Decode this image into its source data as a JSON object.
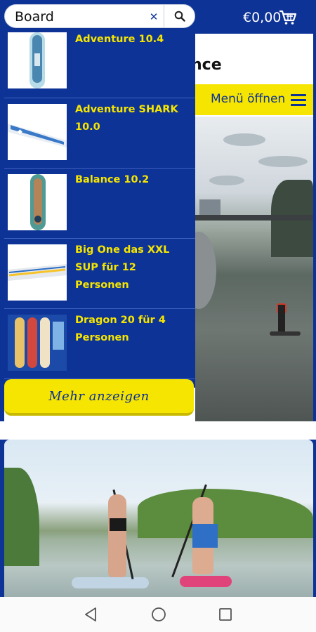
{
  "search": {
    "value": "Board",
    "clear_icon": "close-icon",
    "button_icon": "search-icon"
  },
  "cart": {
    "total": "€0,00",
    "icon": "cart-icon"
  },
  "page": {
    "heading_fragment": "nce"
  },
  "menu": {
    "label": "Menü öffnen",
    "icon": "hamburger-icon"
  },
  "results": [
    {
      "name": "Adventure 10.4"
    },
    {
      "name": "Adventure SHARK 10.0"
    },
    {
      "name": "Balance 10.2"
    },
    {
      "name": "Big One das XXL SUP für 12 Personen"
    },
    {
      "name": "Dragon 20 für 4 Personen"
    }
  ],
  "more_button": {
    "label": "Mehr anzeigen"
  },
  "colors": {
    "brand_blue": "#0d3396",
    "brand_yellow": "#f6e500"
  },
  "system_nav": {
    "back_icon": "back-triangle-icon",
    "home_icon": "home-circle-icon",
    "recents_icon": "recents-square-icon"
  }
}
